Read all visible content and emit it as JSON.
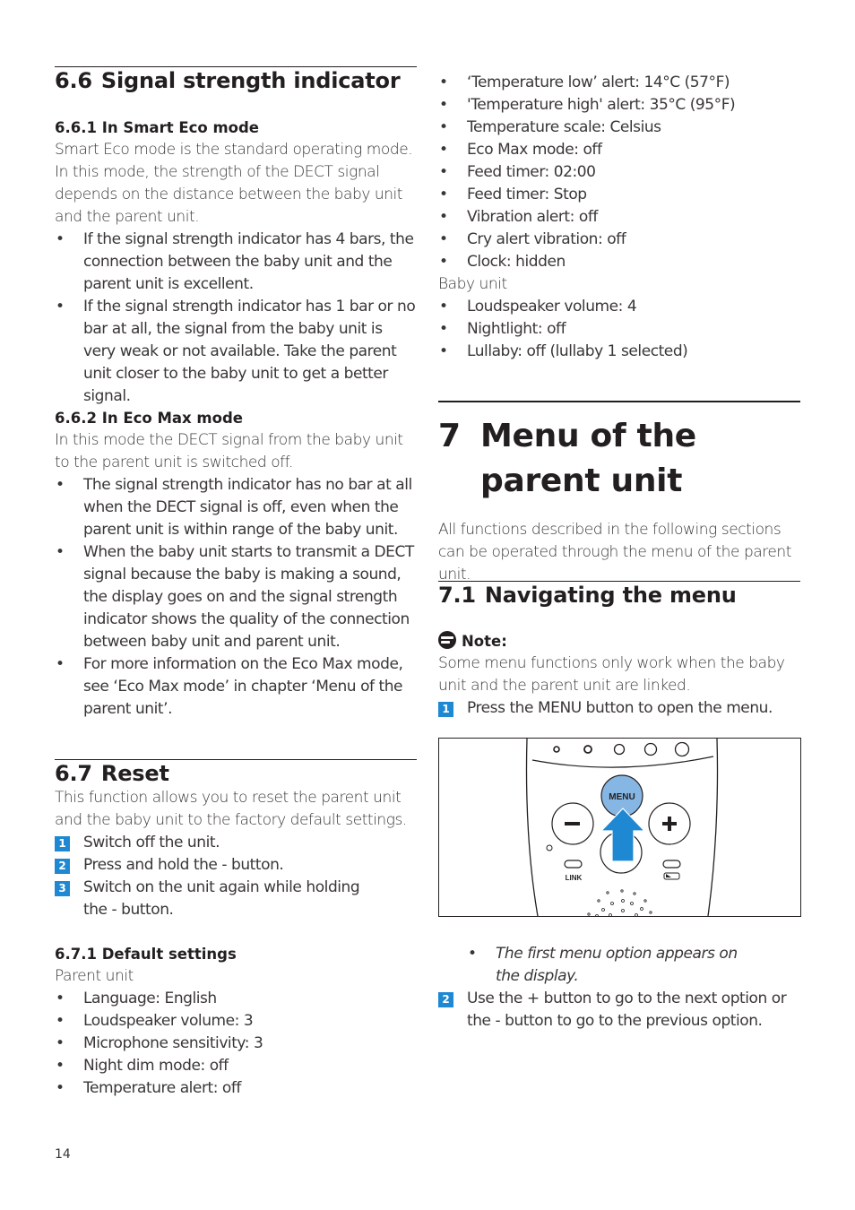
{
  "left_column": {
    "sec_6_6": {
      "number": "6.6",
      "title": "Signal strength indicator",
      "sub_6_6_1": {
        "title": "6.6.1 In Smart Eco mode",
        "body": "Smart Eco mode is the standard operating mode. In this mode, the strength of the DECT signal depends on the distance between the baby unit and the parent unit.",
        "bullets": [
          "If the signal strength indicator has 4 bars, the connection between the baby unit and the parent unit is excellent.",
          "If the signal strength indicator has 1 bar or no bar at all, the signal from the baby unit is very weak or not available. Take the parent unit closer to the baby unit to get a better signal."
        ]
      },
      "sub_6_6_2": {
        "title": "6.6.2 In Eco Max mode",
        "body": "In this mode the DECT signal from the baby unit to the parent unit is switched off.",
        "bullets": [
          "The signal strength indicator has no bar at all when the DECT signal is off, even when the parent unit is within range of the baby unit.",
          "When the baby unit starts to transmit a DECT signal because the baby is making a sound, the display goes on and the signal strength indicator shows the quality of the connection between baby unit and parent unit.",
          "For more information on the Eco Max mode, see ‘Eco Max mode’ in chapter ‘Menu of the parent unit’."
        ]
      }
    },
    "sec_6_7": {
      "number": "6.7",
      "title": "Reset",
      "body": "This function allows you to reset the parent unit and the baby unit to the factory default settings.",
      "steps": [
        {
          "n": "1",
          "text": "Switch off the unit."
        },
        {
          "n": "2",
          "text": "Press and hold the - button."
        },
        {
          "n": "3",
          "text": "Switch on the unit again while holding the - button."
        }
      ],
      "sub_6_7_1": {
        "title": "6.7.1 Default settings",
        "parent_label": "Parent unit",
        "parent_bullets": [
          "Language: English",
          "Loudspeaker volume: 3",
          "Microphone sensitivity: 3",
          "Night dim mode: off",
          "Temperature alert: off"
        ]
      }
    },
    "page_number": "14"
  },
  "right_column": {
    "parent_bullets_cont": [
      "‘Temperature low’ alert: 14°C (57°F)",
      "'Temperature high' alert: 35°C (95°F)",
      "Temperature scale: Celsius",
      "Eco Max mode: off",
      "Feed timer: 02:00",
      "Feed timer: Stop",
      "Vibration alert: off",
      "Cry alert vibration: off",
      "Clock: hidden"
    ],
    "baby_label": "Baby unit",
    "baby_bullets": [
      "Loudspeaker volume: 4",
      "Nightlight: off",
      "Lullaby: off (lullaby 1 selected)"
    ],
    "chapter_7": {
      "number": "7",
      "title": "Menu of the parent unit",
      "body": "All functions described in the following sections can be operated through the menu of the parent unit."
    },
    "sec_7_1": {
      "number": "7.1",
      "title": "Navigating the menu",
      "note_label": "Note:",
      "note_body": "Some menu functions only work when the baby unit and the parent unit are linked.",
      "step1": {
        "n": "1",
        "text": "Press the MENU button to open the menu."
      },
      "figure": {
        "menu_button_label": "MENU",
        "minus_label": "−",
        "plus_label": "+",
        "link_label": "LINK",
        "menu_color": "#86b6e3",
        "arrow_color": "#1e88d2"
      },
      "result_bullet": "The first menu option appears on the display.",
      "step2": {
        "n": "2",
        "text": "Use the + button to go to the next option or the - button to go to the previous option."
      }
    }
  }
}
